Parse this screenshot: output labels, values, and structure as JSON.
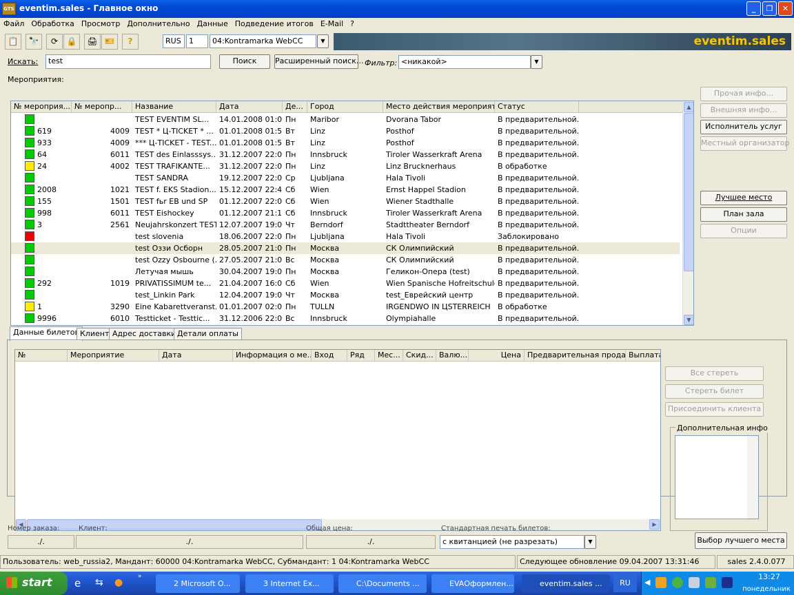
{
  "window": {
    "title": "eventim.sales - Главное окно",
    "logo": "GTS"
  },
  "menu": [
    "Файл",
    "Обработка",
    "Просмотр",
    "Дополнительно",
    "Данные",
    "Подведение итогов",
    "E-Mail",
    "?"
  ],
  "toolbar": {
    "lang": "RUS",
    "num": "1",
    "mandant": "04:Kontramarka WebCC",
    "brand": "eventim.sales"
  },
  "search": {
    "label": "Искать:",
    "value": "test",
    "search_btn": "Поиск",
    "advanced_btn": "Расширенный поиск...",
    "filter_label": "Фильтр:",
    "filter_value": "<никакой>"
  },
  "events_label": "Мероприятия:",
  "events_table": {
    "headers": [
      "№ мероприя...",
      "№ меропр...",
      "Название",
      "Дата",
      "Де...",
      "Город",
      "Место действия мероприят...",
      "Статус"
    ],
    "rows": [
      {
        "status_color": "#00cc00",
        "id": "",
        "num": "",
        "name": "TEST EVENTIM SL...",
        "date": "14.01.2008 01:00",
        "day": "Пн",
        "city": "Maribor",
        "venue": "Dvorana Tabor",
        "status": "В предварительной..."
      },
      {
        "status_color": "#00cc00",
        "id": "619",
        "num": "4009",
        "name": "TEST * Ц-TICKET * ...",
        "date": "01.01.2008 01:57",
        "day": "Вт",
        "city": "Linz",
        "venue": "Posthof",
        "status": "В предварительной..."
      },
      {
        "status_color": "#00cc00",
        "id": "933",
        "num": "4009",
        "name": "*** Ц-TICKET - TEST...",
        "date": "01.01.2008 01:55",
        "day": "Вт",
        "city": "Linz",
        "venue": "Posthof",
        "status": "В предварительной..."
      },
      {
        "status_color": "#00cc00",
        "id": "64",
        "num": "6011",
        "name": "TEST des Einlasssys...",
        "date": "31.12.2007 22:00",
        "day": "Пн",
        "city": "Innsbruck",
        "venue": "Tiroler Wasserkraft Arena",
        "status": "В предварительной..."
      },
      {
        "status_color": "#ffee00",
        "id": "24",
        "num": "4002",
        "name": "TEST TRAFIKANTE...",
        "date": "31.12.2007 22:00",
        "day": "Пн",
        "city": "Linz",
        "venue": "Linz Brucknerhaus",
        "status": "В обработке"
      },
      {
        "status_color": "#00cc00",
        "id": "",
        "num": "",
        "name": "TEST SANDRA",
        "date": "19.12.2007 22:00",
        "day": "Ср",
        "city": "Ljubljana",
        "venue": "Hala Tivoli",
        "status": "В предварительной..."
      },
      {
        "status_color": "#00cc00",
        "id": "2008",
        "num": "1021",
        "name": "TEST f. EKS Stadion...",
        "date": "15.12.2007 22:45",
        "day": "Сб",
        "city": "Wien",
        "venue": "Ernst Happel Stadion",
        "status": "В предварительной..."
      },
      {
        "status_color": "#00cc00",
        "id": "155",
        "num": "1501",
        "name": "TEST fьr EB und SP",
        "date": "01.12.2007 22:00",
        "day": "Сб",
        "city": "Wien",
        "venue": "Wiener Stadthalle",
        "status": "В предварительной..."
      },
      {
        "status_color": "#00cc00",
        "id": "998",
        "num": "6011",
        "name": "TEST Eishockey",
        "date": "01.12.2007 21:15",
        "day": "Сб",
        "city": "Innsbruck",
        "venue": "Tiroler Wasserkraft Arena",
        "status": "В предварительной..."
      },
      {
        "status_color": "#00cc00",
        "id": "3",
        "num": "2561",
        "name": "Neujahrskonzert TEST",
        "date": "12.07.2007 19:00",
        "day": "Чт",
        "city": "Berndorf",
        "venue": "Stadttheater Berndorf",
        "status": "В предварительной..."
      },
      {
        "status_color": "#ee0000",
        "id": "",
        "num": "",
        "name": "test slovenia",
        "date": "18.06.2007 22:00",
        "day": "Пн",
        "city": "Ljubljana",
        "venue": "Hala Tivoli",
        "status": "Заблокировано"
      },
      {
        "status_color": "#00cc00",
        "id": "",
        "num": "",
        "name": "test Оззи Осборн",
        "date": "28.05.2007 21:00",
        "day": "Пн",
        "city": "Москва",
        "venue": "СК Олимпийский",
        "status": "В предварительной..."
      },
      {
        "status_color": "#00cc00",
        "id": "",
        "num": "",
        "name": "test Ozzy Osbourne (...",
        "date": "27.05.2007 21:00",
        "day": "Вс",
        "city": "Москва",
        "venue": "СК Олимпийский",
        "status": "В предварительной..."
      },
      {
        "status_color": "#00cc00",
        "id": "",
        "num": "",
        "name": "Летучая мышь",
        "date": "30.04.2007 19:00",
        "day": "Пн",
        "city": "Москва",
        "venue": "Геликон-Опера (test)",
        "status": "В предварительной..."
      },
      {
        "status_color": "#00cc00",
        "id": "292",
        "num": "1019",
        "name": "PRIVATISSIMUM te...",
        "date": "21.04.2007 16:00",
        "day": "Сб",
        "city": "Wien",
        "venue": "Wien Spanische Hofreitschule",
        "status": "В предварительной..."
      },
      {
        "status_color": "#00cc00",
        "id": "",
        "num": "",
        "name": "test_Linkin Park",
        "date": "12.04.2007 19:00",
        "day": "Чт",
        "city": "Москва",
        "venue": "test_Еврейский центр",
        "status": "В предварительной..."
      },
      {
        "status_color": "#ffee00",
        "id": "1",
        "num": "3290",
        "name": "Eine Kabarettveranst...",
        "date": "01.01.2007 02:01",
        "day": "Пн",
        "city": "TULLN",
        "venue": "IRGENDWO IN ЦSTERREICH",
        "status": "В обработке"
      },
      {
        "status_color": "#00cc00",
        "id": "9996",
        "num": "6010",
        "name": "Testticket  -  Testtic...",
        "date": "31.12.2006 22:00",
        "day": "Вс",
        "city": "Innsbruck",
        "venue": "Olympiahalle",
        "status": "В предварительной..."
      }
    ],
    "selected_row": 11
  },
  "side_buttons": {
    "other_info": "Прочая инфо...",
    "external_info": "Внешняя инфо...",
    "performer": "Исполнитель услуг",
    "local_org": "Местный организатор",
    "best_place": "Лучшее место",
    "hall_plan": "План зала",
    "options": "Опции"
  },
  "tabs": [
    "Данные билетов",
    "Клиент",
    "Адрес доставки",
    "Детали оплаты"
  ],
  "tickets_table": {
    "headers": [
      "№",
      "Мероприятие",
      "Дата",
      "Информация о ме...",
      "Вход",
      "Ряд",
      "Мес...",
      "Скид...",
      "Валю...",
      "Цена",
      "Предварительная прода...",
      "Выплата"
    ]
  },
  "ticket_buttons": {
    "delete_all": "Все стереть",
    "delete_ticket": "Стереть билет",
    "attach_client": "Присоединить клиента",
    "extra_info": "Дополнительная инфо",
    "best_seat": "Выбор лучшего места"
  },
  "bottom": {
    "label1": "Номер заказа:",
    "label2": "Клиент:",
    "label3": "Общая цена:",
    "label4": "Стандартная печать билетов:",
    "v1": "./.",
    "v2": "./.",
    "v3": "./.",
    "print_mode": "с квитанцией (не разрезать)"
  },
  "statusbar": {
    "user": "Пользователь: web_russia2, Мандант: 60000 04:Kontramarka WebCC, Субмандант: 1 04:Kontramarka WebCC",
    "update": "Следующее обновление 09.04.2007 13:31:46",
    "version": "sales 2.4.0.077"
  },
  "taskbar": {
    "start": "start",
    "items": [
      "2 Microsoft O...",
      "3 Internet Ex...",
      "C:\\Documents ...",
      "EVAОформлен...",
      "eventim.sales ..."
    ],
    "lang": "RU",
    "time": "13:27",
    "day": "понедельник"
  }
}
